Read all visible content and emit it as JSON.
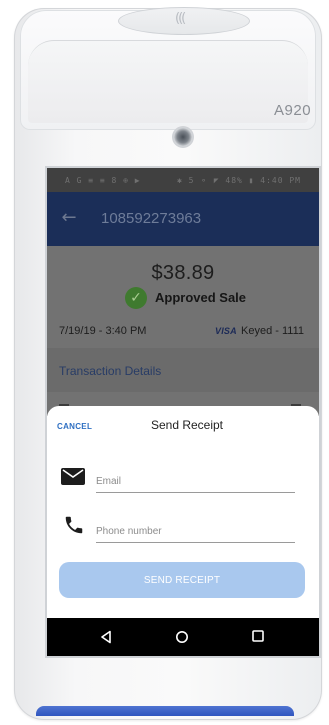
{
  "device": {
    "model": "A920",
    "nfc_symbol": "((("
  },
  "status_bar": {
    "left": "A G ≡ ≡ 8 ⊕ ▶",
    "right": "✱ 5 ⚬ ◤ 48% ▮ 4:40 PM"
  },
  "app_bar": {
    "back_icon": "arrow-left-icon",
    "title": "108592273963"
  },
  "transaction": {
    "amount": "$38.89",
    "status": "Approved Sale",
    "status_icon": "check-circle-icon",
    "datetime": "7/19/19 - 3:40 PM",
    "card_brand": "VISA",
    "card_info": "Keyed - 1111",
    "section_title": "Transaction Details"
  },
  "receipt_sheet": {
    "cancel_label": "CANCEL",
    "title": "Send Receipt",
    "email_placeholder": "Email",
    "email_value": "",
    "phone_placeholder": "Phone number",
    "phone_value": "",
    "send_label": "SEND RECEIPT",
    "send_enabled": false
  },
  "nav_bar": {
    "back_icon": "triangle-back-icon",
    "home_icon": "circle-home-icon",
    "recent_icon": "square-recents-icon"
  },
  "colors": {
    "app_bar": "#1b2e58",
    "accent": "#2e6fc2",
    "send_button_disabled": "#a9c8ee",
    "approved_green": "#3f7a2f"
  }
}
